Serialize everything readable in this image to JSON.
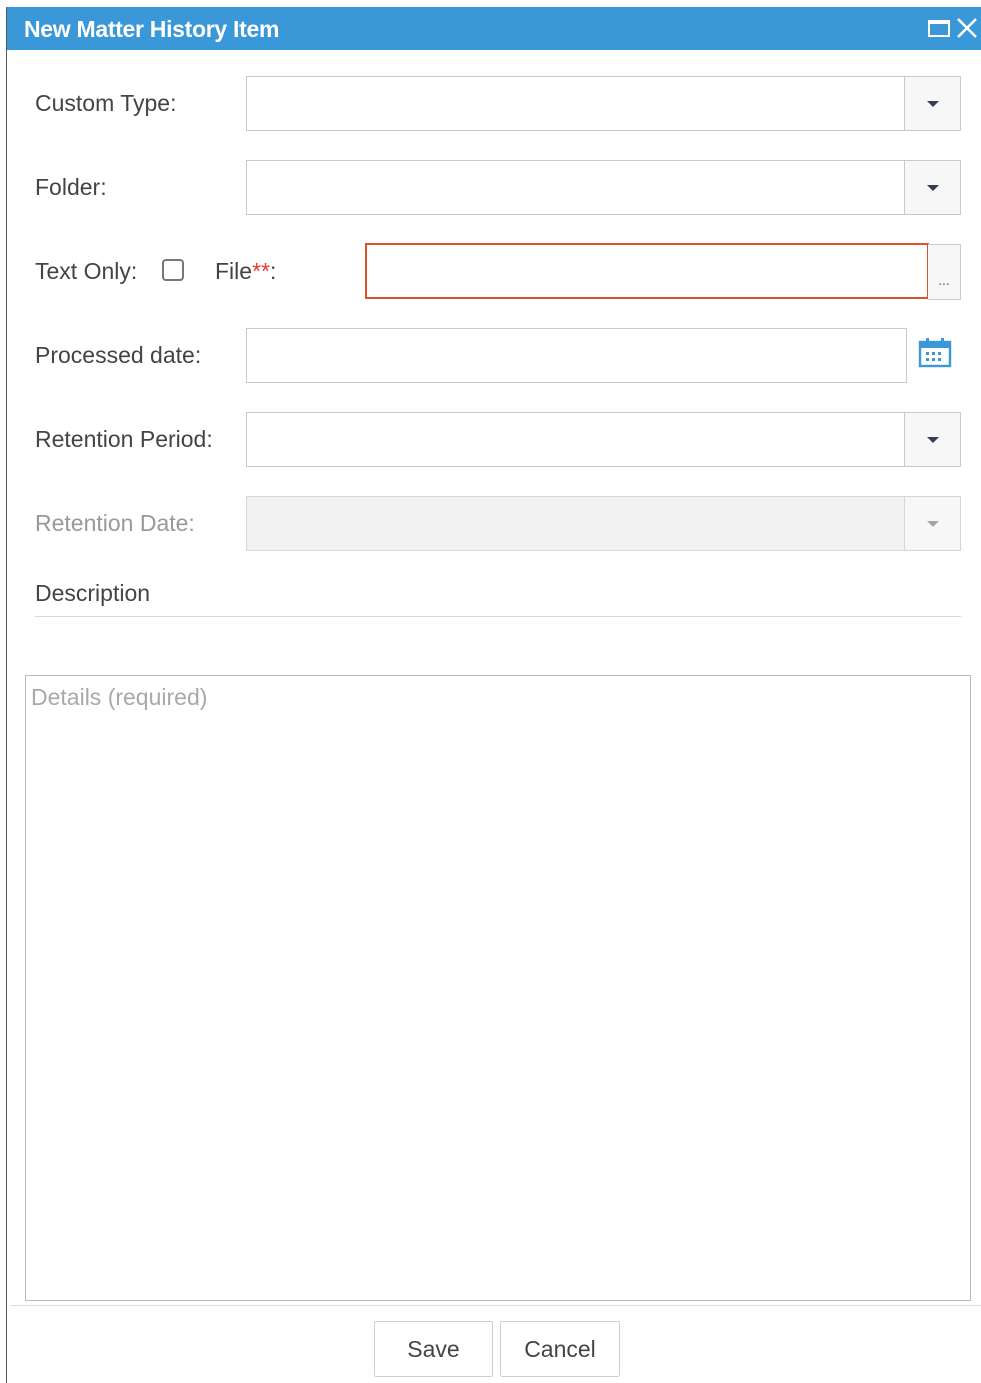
{
  "window": {
    "title": "New Matter History Item",
    "title_color": "#3a97d8",
    "maximize_icon": "maximize-icon",
    "close_icon": "close-icon"
  },
  "form": {
    "custom_type": {
      "label": "Custom Type:",
      "value": ""
    },
    "folder": {
      "label": "Folder:",
      "value": ""
    },
    "text_only": {
      "label": "Text Only:",
      "checked": false
    },
    "file": {
      "label": "File",
      "required_mark": "**",
      "suffix": ":",
      "value": "",
      "browse_label": "..."
    },
    "processed_date": {
      "label": "Processed date:",
      "value": "",
      "icon": "calendar-icon"
    },
    "retention_period": {
      "label": "Retention Period:",
      "value": ""
    },
    "retention_date": {
      "label": "Retention Date:",
      "value": "",
      "disabled": true
    },
    "description": {
      "label": "Description",
      "details_placeholder": "Details (required)"
    }
  },
  "actions": {
    "save_label": "Save",
    "cancel_label": "Cancel"
  },
  "colors": {
    "title_bar": "#3a97d8",
    "error_border": "#d9532c",
    "required_mark": "#e53935",
    "calendar_icon": "#3a97d8"
  }
}
